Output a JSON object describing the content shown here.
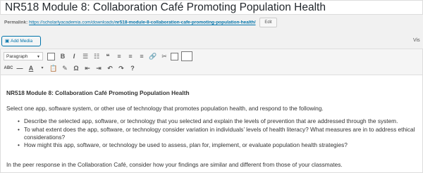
{
  "post": {
    "title": "NR518 Module 8: Collaboration Café Promoting Population Health"
  },
  "permalink": {
    "label": "Permalink:",
    "url_base": "https://scholarlyacademia.com/downloads/",
    "url_slug": "nr518-module-8-collaboration-cafe-promoting-population-health/",
    "edit_label": "Edit"
  },
  "media": {
    "add_media_label": "Add Media",
    "visual_tab_label": "Vis"
  },
  "toolbar": {
    "format_select": "Paragraph",
    "row1": [
      "B",
      "I",
      "☰",
      "☷",
      "❝",
      "≡",
      "≡",
      "≡",
      "🔗",
      "✂"
    ],
    "row2": [
      "ABC",
      "—",
      "A",
      "▾",
      "📋",
      "✎",
      "Ω",
      "⇤",
      "⇥",
      "↶",
      "↷",
      "?"
    ]
  },
  "content": {
    "heading": "NR518 Module 8: Collaboration Café Promoting Population Health",
    "intro": "Select one app, software system, or other use of technology that promotes population health, and respond to the following.",
    "bullets": [
      "Describe the selected app, software, or technology that you selected and explain the levels of prevention that are addressed through the system.",
      "To what extent does the app, software, or technology consider variation in individuals’ levels of health literacy? What measures are in to address ethical considerations?",
      "How might this app, software, or technology be used to assess, plan for, implement, or evaluate population health strategies?"
    ],
    "closing": "In the peer response in the Collaboration Café, consider how your findings are similar and different from those of your classmates."
  }
}
